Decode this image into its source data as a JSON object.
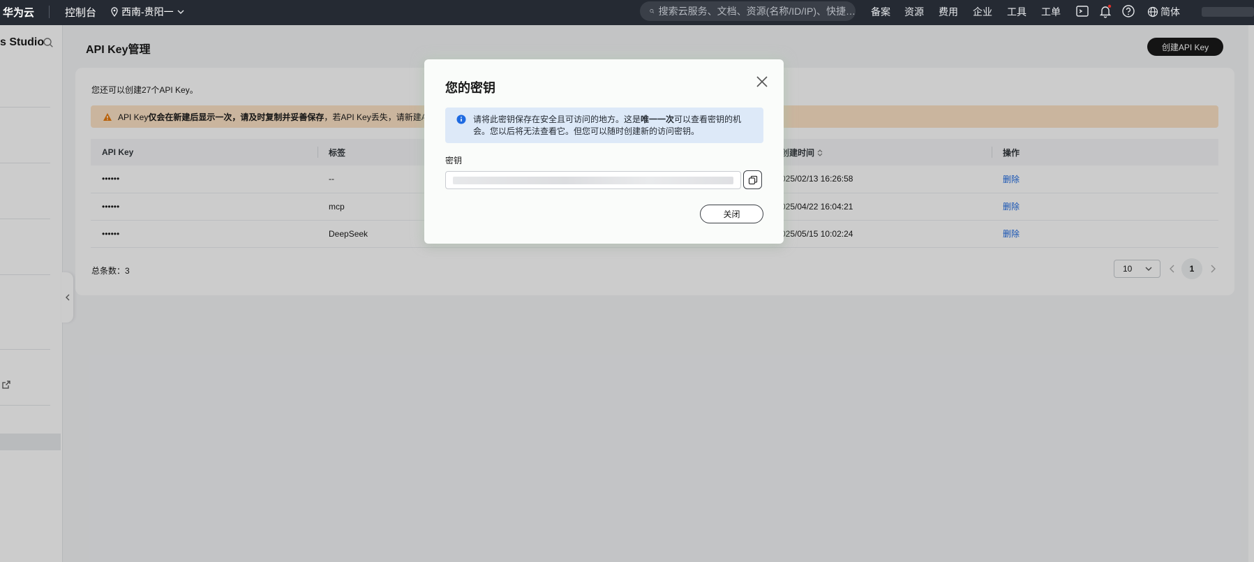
{
  "topbar": {
    "brand": "华为云",
    "console": "控制台",
    "region": "西南-贵阳一",
    "search_placeholder": "搜索云服务、文档、资源(名称/ID/IP)、快捷…",
    "nav": [
      "备案",
      "资源",
      "费用",
      "企业",
      "工具",
      "工单"
    ],
    "language": "简体"
  },
  "sidebar": {
    "title": "s Studio"
  },
  "page": {
    "title": "API Key管理",
    "create_button": "创建API Key",
    "quota_text": "您还可以创建27个API Key。",
    "warning": {
      "prefix": "API Key",
      "bold": "仅会在新建后显示一次，请及时复制并妥善保存",
      "suffix": "，若API Key丢失，请新建API Ke"
    },
    "table": {
      "headers": [
        "API Key",
        "标签",
        "",
        "创建时间",
        "操作"
      ],
      "rows": [
        {
          "key": "••••••",
          "tag": "--",
          "time": "025/02/13 16:26:58",
          "action": "删除"
        },
        {
          "key": "••••••",
          "tag": "mcp",
          "time": "025/04/22 16:04:21",
          "action": "删除"
        },
        {
          "key": "••••••",
          "tag": "DeepSeek",
          "time": "025/05/15 10:02:24",
          "action": "删除"
        }
      ]
    },
    "total": "总条数：3",
    "page_size": "10",
    "current_page": "1"
  },
  "modal": {
    "title": "您的密钥",
    "info_before": "请将此密钥保存在安全且可访问的地方。这是",
    "info_bold": "唯一一次",
    "info_after": "可以查看密钥的机会。您以后将无法查看它。但您可以随时创建新的访问密钥。",
    "key_label": "密钥",
    "close_button": "关闭"
  }
}
